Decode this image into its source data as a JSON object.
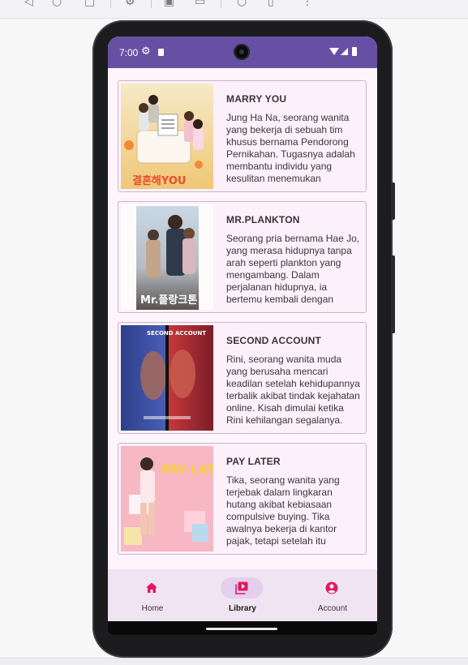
{
  "status_bar": {
    "time": "7:00"
  },
  "movies": [
    {
      "title": "MARRY YOU",
      "description": "Jung Ha Na, seorang wanita yang bekerja di sebuah tim khusus bernama Pendorong Pernikahan. Tugasnya adalah membantu individu yang kesulitan menemukan pasangan hidup.",
      "poster_text": "결혼해YOU"
    },
    {
      "title": "MR.PLANKTON",
      "description": "Seorang pria bernama Hae Jo, yang merasa hidupnya tanpa arah seperti plankton yang mengambang. Dalam perjalanan hidupnya, ia bertemu kembali dengan mantan kekasihnya.",
      "poster_text": "Mr.플랑크톤"
    },
    {
      "title": "SECOND ACCOUNT",
      "description": "Rini, seorang wanita muda yang berusaha mencari keadilan setelah kehidupannya terbalik akibat tindak kejahatan online. Kisah dimulai ketika Rini kehilangan segalanya.",
      "poster_text": "SECOND ACCOUNT"
    },
    {
      "title": "PAY LATER",
      "description": "Tika, seorang wanita yang terjebak dalam lingkaran hutang akibat kebiasaan compulsive buying. Tika awalnya bekerja di kantor pajak, tetapi setelah itu hidupnya berubah.",
      "poster_text": "PAY LATER"
    }
  ],
  "nav": {
    "items": [
      {
        "label": "Home",
        "icon": "home-icon",
        "active": false
      },
      {
        "label": "Library",
        "icon": "video-library-icon",
        "active": true
      },
      {
        "label": "Account",
        "icon": "account-circle-icon",
        "active": false
      }
    ]
  },
  "colors": {
    "status_bar": "#6750a4",
    "accent": "#e0195f",
    "card_background": "#fcf1fa",
    "nav_background": "#f0e4f3",
    "active_pill": "#e4d0ee"
  }
}
